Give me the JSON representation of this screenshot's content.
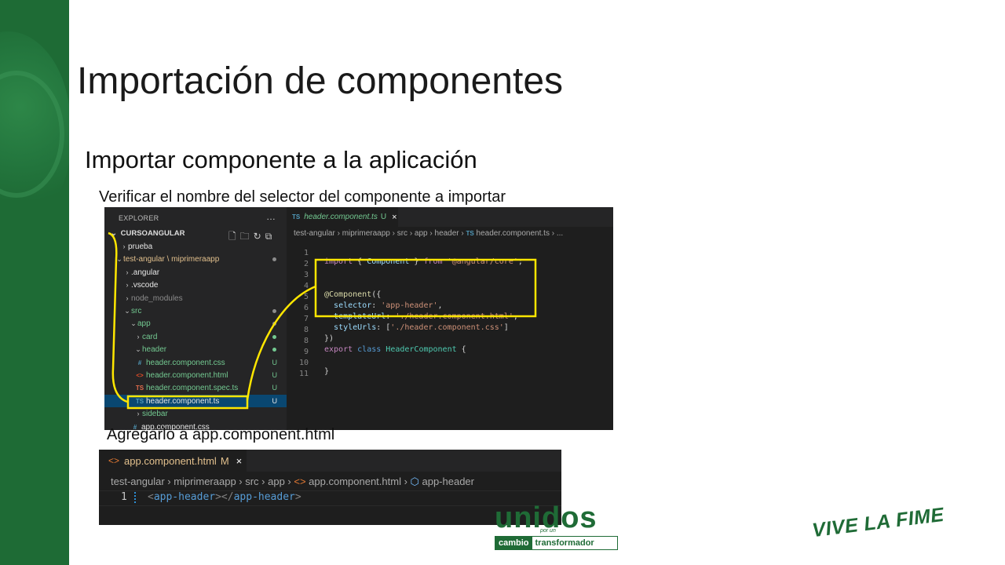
{
  "slide": {
    "title": "Importación de componentes",
    "subtitle": "Importar componente a la aplicación",
    "step1": "Verificar el nombre del selector del componente a importar",
    "step2": "Agregarlo a app.component.html"
  },
  "screenshot1": {
    "explorer_header": "EXPLORER",
    "more_icon": "…",
    "project": "CURSOANGULAR",
    "tree": [
      {
        "label": "prueba",
        "chevron": "›",
        "icon": "",
        "status": ""
      },
      {
        "label": "test-angular \\ miprimeraapp",
        "chevron": "⌄",
        "icon": "",
        "status": "dot"
      },
      {
        "label": ".angular",
        "chevron": "›",
        "icon": "",
        "status": ""
      },
      {
        "label": ".vscode",
        "chevron": "›",
        "icon": "",
        "status": ""
      },
      {
        "label": "node_modules",
        "chevron": "›",
        "icon": "",
        "status": ""
      },
      {
        "label": "src",
        "chevron": "⌄",
        "icon": "",
        "status": "dot"
      },
      {
        "label": "app",
        "chevron": "⌄",
        "icon": "",
        "status": "dot"
      },
      {
        "label": "card",
        "chevron": "›",
        "icon": "",
        "status": "dot"
      },
      {
        "label": "header",
        "chevron": "⌄",
        "icon": "",
        "status": "dot"
      },
      {
        "label": "header.component.css",
        "chevron": "",
        "icon": "#",
        "status": "U"
      },
      {
        "label": "header.component.html",
        "chevron": "",
        "icon": "<>",
        "status": "U"
      },
      {
        "label": "header.component.spec.ts",
        "chevron": "",
        "icon": "TS",
        "status": "U"
      },
      {
        "label": "header.component.ts",
        "chevron": "",
        "icon": "TS",
        "status": "U"
      },
      {
        "label": "sidebar",
        "chevron": "›",
        "icon": "",
        "status": ""
      },
      {
        "label": "app.component.css",
        "chevron": "",
        "icon": "#",
        "status": ""
      }
    ],
    "tab": {
      "icon": "TS",
      "name": "header.component.ts",
      "status": "U",
      "close": "×"
    },
    "breadcrumb": "test-angular › miprimeraapp › src › app › header › ",
    "breadcrumb_file": "header.component.ts › ...",
    "breadcrumb_ts": "TS",
    "line_numbers": [
      "1",
      "2",
      "3",
      "4",
      "5",
      "6",
      "7",
      "8",
      "9",
      "10",
      "11"
    ]
  },
  "screenshot2": {
    "tab_icon": "<>",
    "tab_name": "app.component.html",
    "tab_status": "M",
    "tab_close": "×",
    "breadcrumb_path": "test-angular › miprimeraapp › src › app › ",
    "breadcrumb_icon": "<>",
    "breadcrumb_file": " app.component.html › ",
    "breadcrumb_cube": "⬡",
    "breadcrumb_symbol": " app-header",
    "line_number": "1",
    "tag_open_lt": "<",
    "tag_open_name": "app-header",
    "tag_mid": "></",
    "tag_close_name": "app-header",
    "tag_close_gt": ">"
  },
  "logos": {
    "unidos": "unidos",
    "por_un": "por un",
    "cambio": "cambio",
    "transformador": "transformador",
    "vive": "VIVE LA FIME"
  },
  "colors": {
    "brand_green": "#1e6b35",
    "highlight": "#ffe600"
  }
}
